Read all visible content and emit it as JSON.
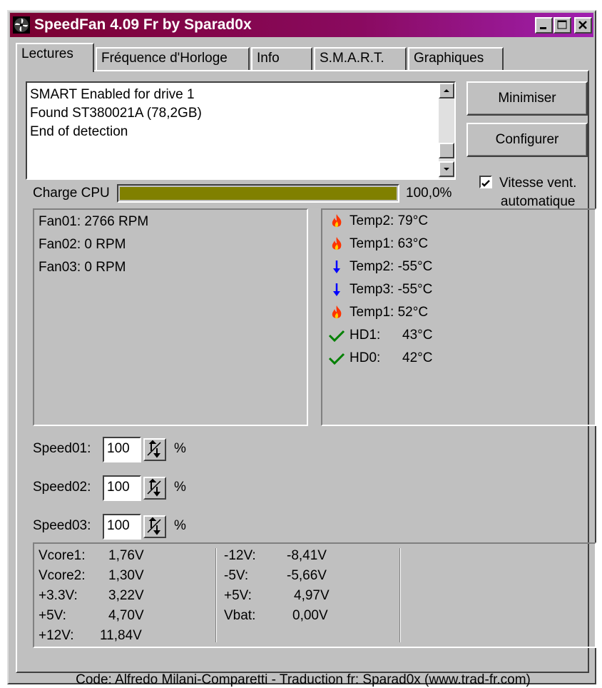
{
  "window": {
    "title": "SpeedFan 4.09 Fr by Sparad0x",
    "controls": [
      "minimize-icon",
      "maximize-icon",
      "close-icon"
    ]
  },
  "tabs": [
    {
      "label": "Lectures",
      "active": true
    },
    {
      "label": "Fréquence d'Horloge",
      "active": false
    },
    {
      "label": "Info",
      "active": false
    },
    {
      "label": "S.M.A.R.T.",
      "active": false
    },
    {
      "label": "Graphiques",
      "active": false
    }
  ],
  "log": {
    "lines": [
      "SMART Enabled for drive 1",
      "Found ST380021A (78,2GB)",
      "End of detection"
    ]
  },
  "buttons": {
    "minimize": "Minimiser",
    "configure": "Configurer"
  },
  "auto_fan": {
    "checked": true,
    "label_line1": "Vitesse vent.",
    "label_line2": "automatique"
  },
  "cpu": {
    "label": "Charge CPU",
    "percent_text": "100,0%",
    "load_fraction": 1.0,
    "bar_color": "#808000"
  },
  "fans": [
    "Fan01: 2766 RPM",
    "Fan02: 0 RPM",
    "Fan03: 0 RPM"
  ],
  "temps": [
    {
      "icon": "flame-icon",
      "label": "Temp2: 79°C"
    },
    {
      "icon": "flame-icon",
      "label": "Temp1: 63°C"
    },
    {
      "icon": "arrow-down-icon",
      "label": "Temp2: -55°C"
    },
    {
      "icon": "arrow-down-icon",
      "label": "Temp3: -55°C"
    },
    {
      "icon": "flame-icon",
      "label": "Temp1: 52°C"
    },
    {
      "icon": "checkmark-icon",
      "label": "HD1:",
      "value": "43°C"
    },
    {
      "icon": "checkmark-icon",
      "label": "HD0:",
      "value": "42°C"
    }
  ],
  "speeds": [
    {
      "label": "Speed01:",
      "value": "100",
      "unit": "%"
    },
    {
      "label": "Speed02:",
      "value": "100",
      "unit": "%"
    },
    {
      "label": "Speed03:",
      "value": "100",
      "unit": "%"
    }
  ],
  "voltages_col1": [
    {
      "name": "Vcore1:",
      "value": "1,76V"
    },
    {
      "name": "Vcore2:",
      "value": "1,30V"
    },
    {
      "name": "+3.3V:",
      "value": "3,22V"
    },
    {
      "name": "+5V:",
      "value": "4,70V"
    },
    {
      "name": "+12V:",
      "value": "11,84V"
    }
  ],
  "voltages_col2": [
    {
      "name": "-12V:",
      "value": "-8,41V"
    },
    {
      "name": "-5V:",
      "value": "-5,66V"
    },
    {
      "name": "+5V:",
      "value": "4,97V"
    },
    {
      "name": "Vbat:",
      "value": "0,00V"
    }
  ],
  "status_bar": "Code: Alfredo Milani-Comparetti - Traduction fr: Sparad0x (www.trad-fr.com)",
  "colors": {
    "title_start": "#7a0030",
    "title_end": "#a020b0",
    "face": "#c0c0c0",
    "flame": "#ff3300",
    "arrow": "#0000ff",
    "check": "#008000"
  }
}
